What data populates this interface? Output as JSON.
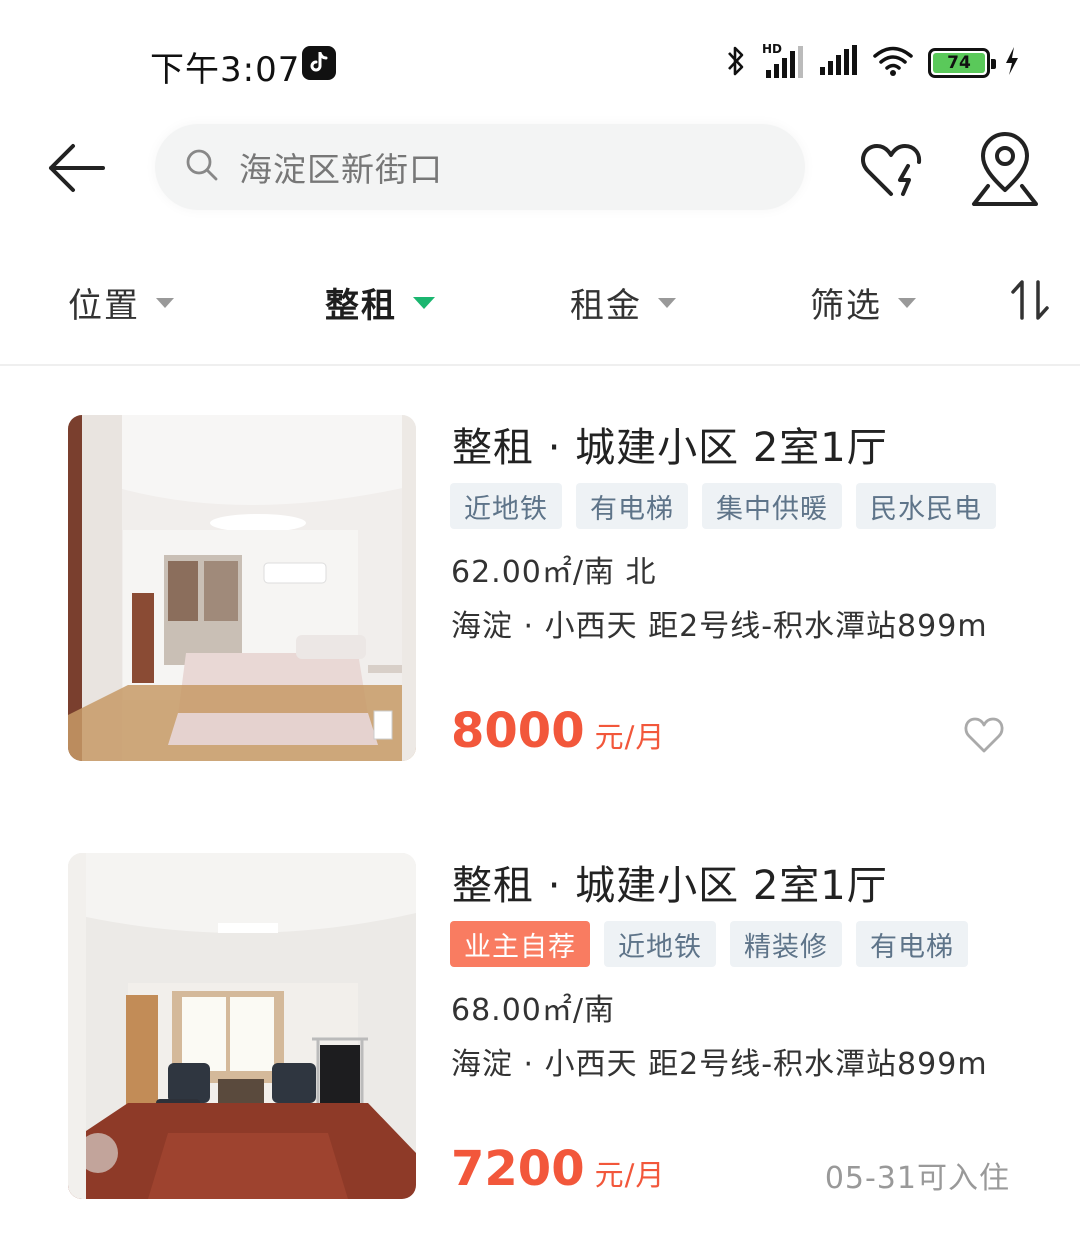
{
  "status_bar": {
    "time": "下午3:07",
    "network_label": "HD",
    "battery_level": "74"
  },
  "search": {
    "value": "海淀区新街口"
  },
  "filters": [
    {
      "label": "位置",
      "active": false
    },
    {
      "label": "整租",
      "active": true
    },
    {
      "label": "租金",
      "active": false
    },
    {
      "label": "筛选",
      "active": false
    }
  ],
  "colors": {
    "accent_green": "#1bb670",
    "price_red": "#f2573b",
    "tag_bg": "#eef2f5",
    "tag_text": "#5e7489",
    "owner_tag_bg": "#f97c61"
  },
  "listings": [
    {
      "title": "整租 · 城建小区 2室1厅",
      "tags": [
        "近地铁",
        "有电梯",
        "集中供暖",
        "民水民电"
      ],
      "area": "62.00㎡/南 北",
      "location": "海淀 · 小西天 距2号线-积水潭站899m",
      "price": "8000",
      "unit": "元/月",
      "favorite_icon": "heart-outline-icon"
    },
    {
      "title": "整租 · 城建小区 2室1厅",
      "owner_tag": "业主自荐",
      "tags": [
        "近地铁",
        "精装修",
        "有电梯"
      ],
      "area": "68.00㎡/南",
      "location": "海淀 · 小西天 距2号线-积水潭站899m",
      "price": "7200",
      "unit": "元/月",
      "available": "05-31可入住"
    }
  ]
}
